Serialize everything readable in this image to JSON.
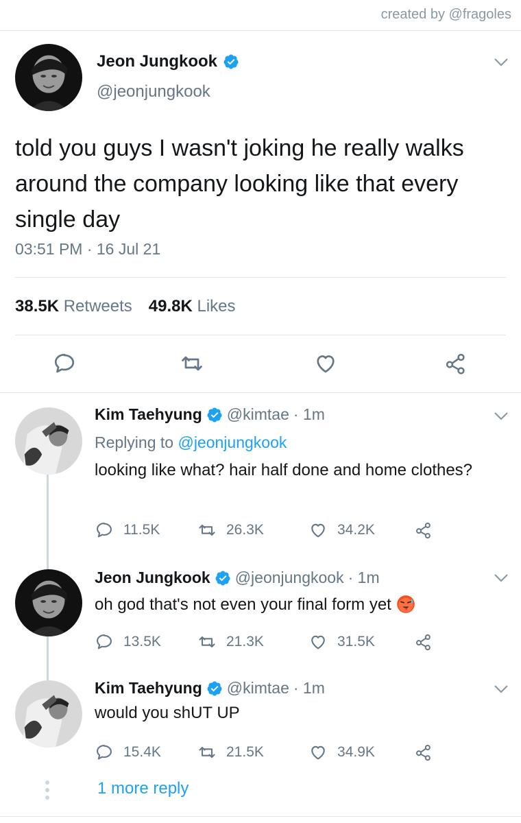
{
  "credit": "created by @fragoles",
  "main_tweet": {
    "name": "Jeon Jungkook",
    "handle": "@jeonjungkook",
    "text": "told you guys I wasn't joking he really walks around the company looking like that every single day",
    "timestamp": "03:51 PM · 16 Jul 21",
    "retweets_count": "38.5K",
    "retweets_label": "Retweets",
    "likes_count": "49.8K",
    "likes_label": "Likes",
    "actions": [
      "reply-icon",
      "retweet-icon",
      "like-icon",
      "share-icon"
    ]
  },
  "replies": [
    {
      "name": "Kim Taehyung",
      "handle": "@kimtae",
      "time": "· 1m",
      "replying_prefix": "Replying to",
      "replying_to": "@jeonjungkook",
      "text": "looking like what? hair half done and home clothes?",
      "reply_count": "11.5K",
      "retweet_count": "26.3K",
      "like_count": "34.2K"
    },
    {
      "name": "Jeon Jungkook",
      "handle": "@jeonjungkook",
      "time": "· 1m",
      "text": "oh god that's not even your final form yet",
      "emoji": "hot-face-emoji",
      "reply_count": "13.5K",
      "retweet_count": "21.3K",
      "like_count": "31.5K"
    },
    {
      "name": "Kim Taehyung",
      "handle": "@kimtae",
      "time": "· 1m",
      "text": "would you shUT UP",
      "reply_count": "15.4K",
      "retweet_count": "21.5K",
      "like_count": "34.9K"
    }
  ],
  "more_replies": "1 more reply",
  "colors": {
    "accent": "#1da1f2",
    "secondary_text": "#657786",
    "divider": "#e1e8ed",
    "thread_line": "#ccd6dd"
  }
}
